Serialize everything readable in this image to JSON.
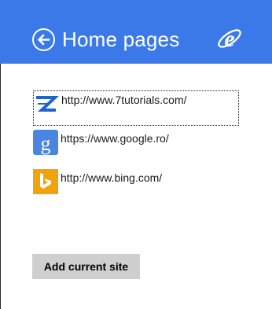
{
  "header": {
    "title": "Home pages",
    "back_icon": "back-arrow-circle-icon",
    "app_icon": "internet-explorer-icon",
    "background_color": "#3b79e8"
  },
  "home_pages": [
    {
      "url": "http://www.7tutorials.com/",
      "icon": "7tutorials-icon",
      "focused": true
    },
    {
      "url": "https://www.google.ro/",
      "icon": "google-icon",
      "focused": false
    },
    {
      "url": "http://www.bing.com/",
      "icon": "bing-icon",
      "focused": false
    }
  ],
  "actions": {
    "add_current_site_label": "Add current site"
  }
}
